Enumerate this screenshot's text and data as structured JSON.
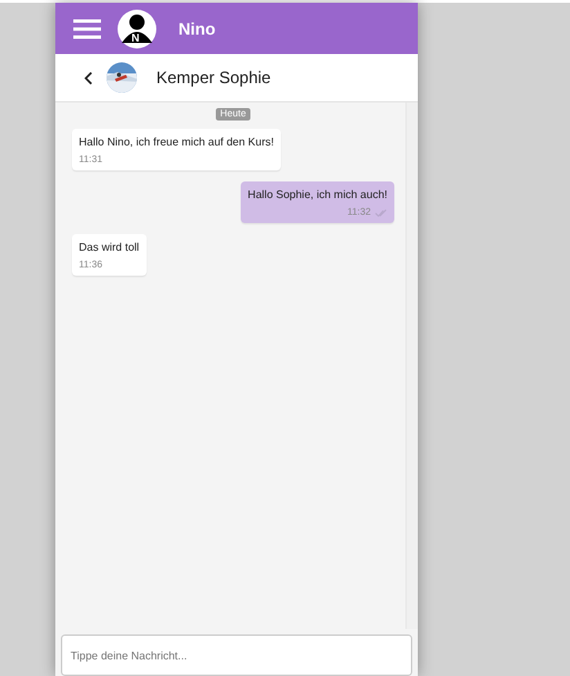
{
  "app_bar": {
    "user_name": "Nino",
    "avatar_letter": "N"
  },
  "chat_header": {
    "contact_name": "Kemper Sophie"
  },
  "date_badge": "Heute",
  "messages": [
    {
      "kind": "incoming",
      "text": "Hallo Nino, ich freue mich auf den Kurs!",
      "time": "11:31"
    },
    {
      "kind": "outgoing",
      "text": "Hallo Sophie, ich mich auch!",
      "time": "11:32"
    },
    {
      "kind": "incoming",
      "text": "Das wird toll",
      "time": "11:36"
    }
  ],
  "composer": {
    "placeholder": "Tippe deine Nachricht..."
  }
}
